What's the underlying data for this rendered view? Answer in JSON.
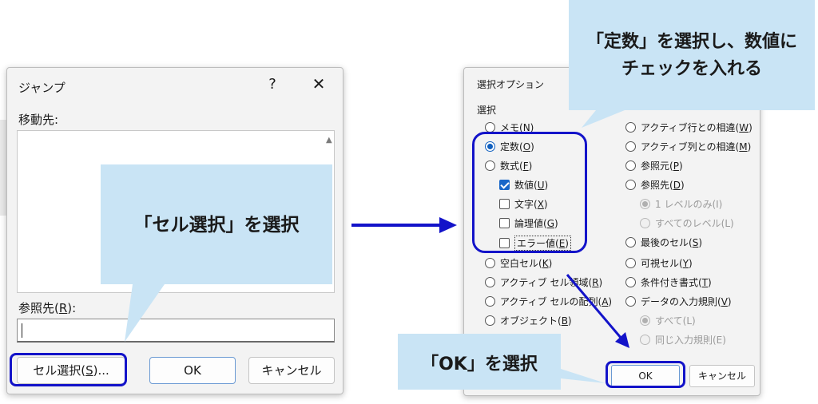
{
  "jump_dialog": {
    "title": "ジャンプ",
    "help_glyph": "?",
    "close_glyph": "✕",
    "destination_label": "移動先:",
    "reference_label_prefix": "参照先(",
    "reference_label_key": "R",
    "reference_label_suffix": "):",
    "reference_value": "",
    "special_button": {
      "prefix": "セル選択(",
      "key": "S",
      "suffix": ")..."
    },
    "ok_button": "OK",
    "cancel_button": "キャンセル"
  },
  "option_dialog": {
    "title": "選択オプション",
    "group_label": "選択",
    "left_options": [
      {
        "text": "メモ(",
        "key": "N",
        "close": ")"
      },
      {
        "text": "定数(",
        "key": "O",
        "close": ")"
      },
      {
        "text": "数式(",
        "key": "F",
        "close": ")"
      },
      {
        "text": "数値(",
        "key": "U",
        "close": ")"
      },
      {
        "text": "文字(",
        "key": "X",
        "close": ")"
      },
      {
        "text": "論理値(",
        "key": "G",
        "close": ")"
      },
      {
        "text": "エラー値(",
        "key": "E",
        "close": ")"
      },
      {
        "text": "空白セル(",
        "key": "K",
        "close": ")"
      },
      {
        "text": "アクティブ セル領域(",
        "key": "R",
        "close": ")"
      },
      {
        "text": "アクティブ セルの配列(",
        "key": "A",
        "close": ")"
      },
      {
        "text": "オブジェクト(",
        "key": "B",
        "close": ")"
      }
    ],
    "right_options": [
      {
        "text": "アクティブ行との相違(",
        "key": "W",
        "close": ")"
      },
      {
        "text": "アクティブ列との相違(",
        "key": "M",
        "close": ")"
      },
      {
        "text": "参照元(",
        "key": "P",
        "close": ")"
      },
      {
        "text": "参照先(",
        "key": "D",
        "close": ")"
      },
      {
        "text": "1 レベルのみ(I)"
      },
      {
        "text": "すべてのレベル(L)"
      },
      {
        "text": "最後のセル(",
        "key": "S",
        "close": ")"
      },
      {
        "text": "可視セル(",
        "key": "Y",
        "close": ")"
      },
      {
        "text": "条件付き書式(",
        "key": "T",
        "close": ")"
      },
      {
        "text": "データの入力規則(",
        "key": "V",
        "close": ")"
      },
      {
        "text": "すべて(L)"
      },
      {
        "text": "同じ入力規則(E)"
      }
    ],
    "ok_button": "OK",
    "cancel_button": "キャンセル"
  },
  "callouts": {
    "cell_select": "「セル選択」を選択",
    "constants_line1": "「定数」を選択し、数値に",
    "constants_line2": "チェックを入れる",
    "ok_select": "「OK」を選択"
  },
  "colors": {
    "callout_bg": "#c9e4f5",
    "highlight": "#1313c9",
    "arrow": "#1313c9"
  }
}
